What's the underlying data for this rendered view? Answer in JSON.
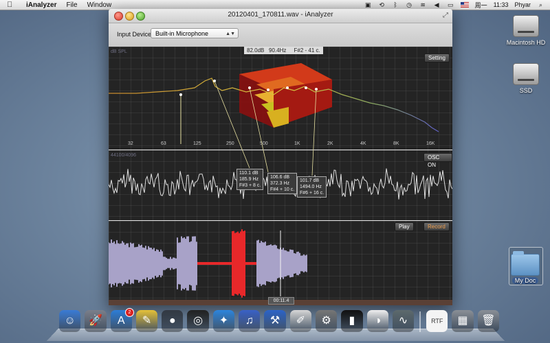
{
  "menubar": {
    "app_name": "iAnalyzer",
    "menus": [
      "File",
      "Window"
    ],
    "status": {
      "date": "周一",
      "time": "11:33",
      "user": "Phyar"
    }
  },
  "desktop": {
    "icons": [
      {
        "label": "Macintosh HD"
      },
      {
        "label": "SSD"
      },
      {
        "label": "My Doc"
      }
    ]
  },
  "window": {
    "title": "20120401_170811.wav - iAnalyzer",
    "toolbar": {
      "input_label": "Input Device",
      "input_value": "Built-in Microphone"
    },
    "spectrum": {
      "y_unit": "dB SPL",
      "readout_db": "82.0dB",
      "readout_hz": "90.4Hz",
      "readout_note": "F#2 - 41 c.",
      "setting_label": "Setting",
      "x_ticks": [
        "32",
        "63",
        "125",
        "250",
        "500",
        "1K",
        "2K",
        "4K",
        "8K",
        "16K"
      ]
    },
    "oscilloscope": {
      "info": "44100/4096",
      "osc_label": "OSC ON"
    },
    "peaks": [
      {
        "db": "110.1 dB",
        "hz": "185.9 Hz",
        "note": "F#3 + 8 c."
      },
      {
        "db": "106.6 dB",
        "hz": "372.3 Hz",
        "note": "F#4 + 10 c."
      },
      {
        "db": "101.7 dB",
        "hz": "1494.0 Hz",
        "note": "F#6 + 16 c."
      }
    ],
    "recorder": {
      "play_label": "Play",
      "record_label": "Record",
      "time": "00:11.4"
    }
  },
  "dock": {
    "items": [
      {
        "name": "finder-icon",
        "glyph": "☺"
      },
      {
        "name": "launchpad-icon",
        "glyph": "🚀"
      },
      {
        "name": "app-store-icon",
        "glyph": "A",
        "badge": "2"
      },
      {
        "name": "stickies-icon",
        "glyph": "✎"
      },
      {
        "name": "facetime-icon",
        "glyph": "●"
      },
      {
        "name": "dashboard-icon",
        "glyph": "◎"
      },
      {
        "name": "safari-icon",
        "glyph": "✦"
      },
      {
        "name": "itunes-icon",
        "glyph": "♫"
      },
      {
        "name": "xcode-icon",
        "glyph": "⚒"
      },
      {
        "name": "textedit-icon",
        "glyph": "✐"
      },
      {
        "name": "system-preferences-icon",
        "glyph": "⚙"
      },
      {
        "name": "terminal-icon",
        "glyph": "▮"
      },
      {
        "name": "color-wheel-icon",
        "glyph": "◑"
      },
      {
        "name": "ianalyzer-icon",
        "glyph": "∿"
      }
    ],
    "right_items": [
      {
        "name": "document-icon",
        "glyph": "RTF"
      },
      {
        "name": "stack-icon",
        "glyph": "▦"
      },
      {
        "name": "trash-icon",
        "glyph": "🗑"
      }
    ]
  }
}
